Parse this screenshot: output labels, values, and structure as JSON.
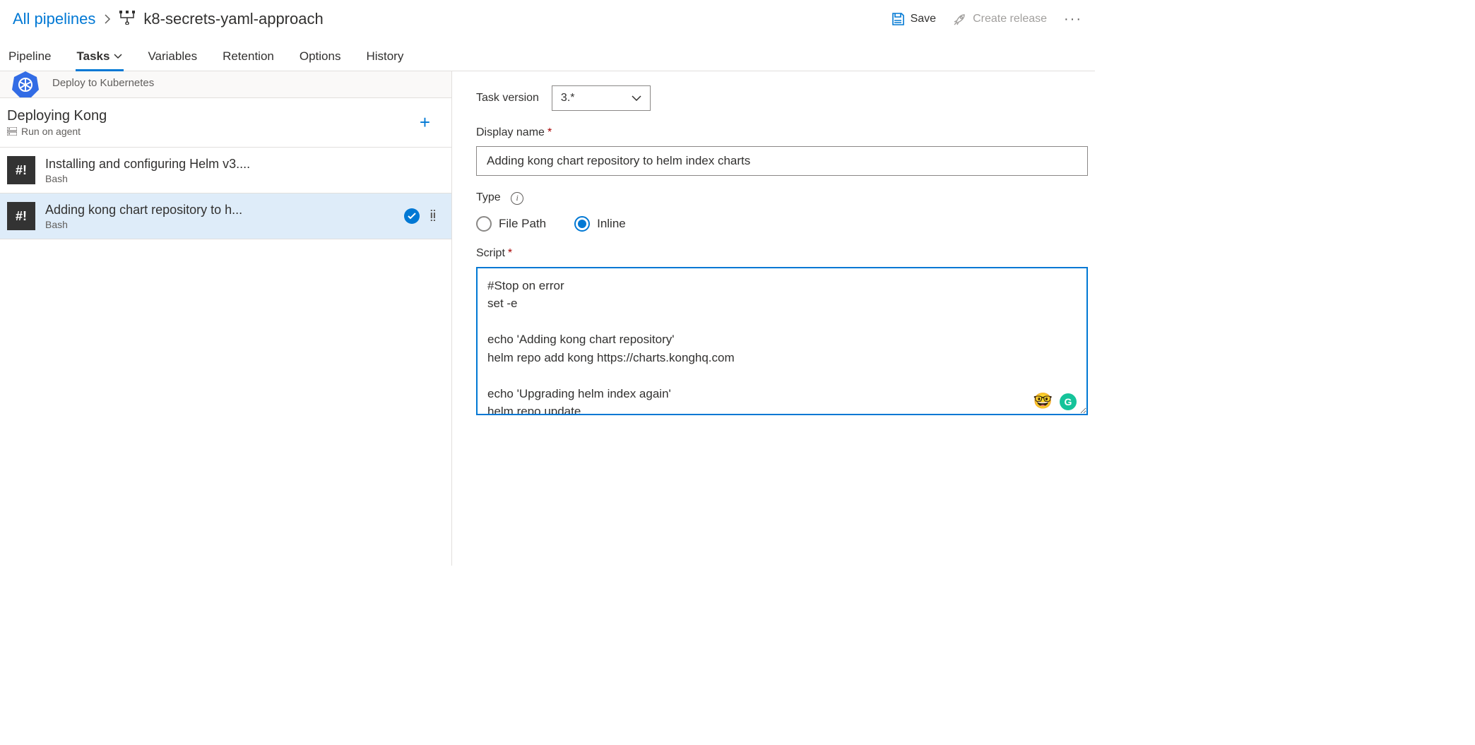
{
  "breadcrumb": {
    "root": "All pipelines",
    "title": "k8-secrets-yaml-approach"
  },
  "header_actions": {
    "save": "Save",
    "create_release": "Create release"
  },
  "tabs": {
    "pipeline": "Pipeline",
    "tasks": "Tasks",
    "variables": "Variables",
    "retention": "Retention",
    "options": "Options",
    "history": "History"
  },
  "left": {
    "stage_sub": "Deploy to Kubernetes",
    "job_title": "Deploying Kong",
    "job_sub": "Run on agent",
    "tasks": [
      {
        "title": "Installing and configuring Helm v3....",
        "type": "Bash"
      },
      {
        "title": "Adding kong chart repository to h...",
        "type": "Bash"
      }
    ]
  },
  "form": {
    "task_version_label": "Task version",
    "task_version_value": "3.*",
    "display_name_label": "Display name",
    "display_name_value": "Adding kong chart repository to helm index charts",
    "type_label": "Type",
    "type_options": {
      "file_path": "File Path",
      "inline": "Inline"
    },
    "script_label": "Script",
    "script_value": "#Stop on error\nset -e\n\necho 'Adding kong chart repository'\nhelm repo add kong https://charts.konghq.com\n\necho 'Upgrading helm index again'\nhelm repo update"
  }
}
